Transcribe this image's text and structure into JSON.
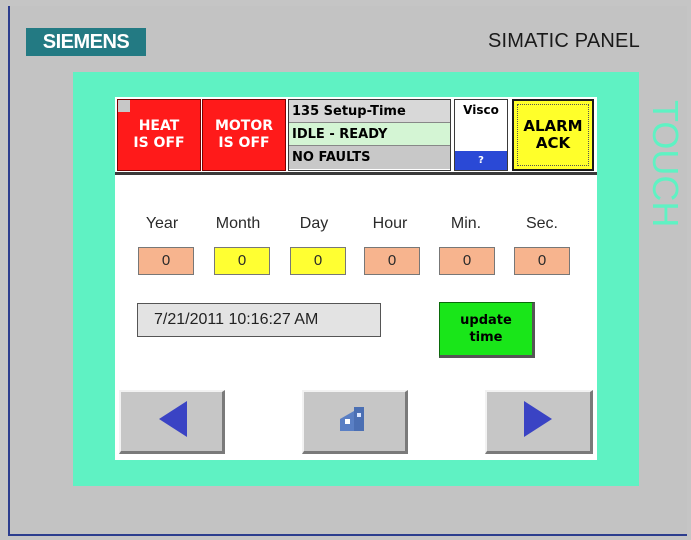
{
  "brand": {
    "logo": "SIEMENS",
    "model": "SIMATIC PANEL",
    "bezel_text": "TOUCH"
  },
  "header": {
    "heat_button": "HEAT IS OFF",
    "motor_button": "MOTOR IS OFF",
    "status_rows": [
      "135 Setup-Time",
      "IDLE - READY",
      "NO FAULTS"
    ],
    "visco_label": "Visco",
    "visco_value": "?",
    "alarm_button": "ALARM ACK"
  },
  "time_set": {
    "labels": [
      "Year",
      "Month",
      "Day",
      "Hour",
      "Min.",
      "Sec."
    ],
    "values": [
      "0",
      "0",
      "0",
      "0",
      "0",
      "0"
    ]
  },
  "current_datetime": "7/21/2011 10:16:27 AM",
  "update_button": "update time",
  "navigation": {
    "prev": "left-arrow-icon",
    "home": "home-icon",
    "next": "right-arrow-icon"
  },
  "colors": {
    "bezel": "#5ff2c3",
    "heat_motor": "#ff1a1a",
    "alarm": "#ffff2a",
    "update": "#19e619",
    "field_peach": "#f7b48e",
    "field_yellow": "#ffff32",
    "arrow": "#3a43c4"
  }
}
